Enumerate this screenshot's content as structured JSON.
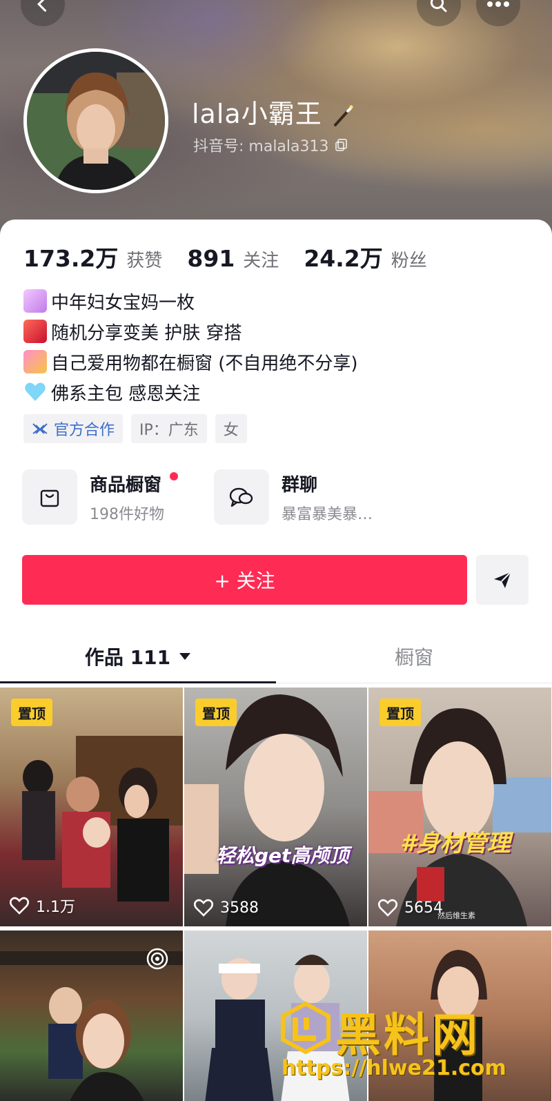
{
  "profile": {
    "name": "lala小霸王",
    "douyin_id": "抖音号: malala313"
  },
  "stats": [
    {
      "value": "173.2万",
      "label": "获赞"
    },
    {
      "value": "891",
      "label": "关注"
    },
    {
      "value": "24.2万",
      "label": "粉丝"
    }
  ],
  "bio": [
    {
      "icon": "unicorn-emoji",
      "text": "中年妇女宝妈一枚"
    },
    {
      "icon": "dancer-emoji",
      "text": "随机分享变美 护肤 穿搭"
    },
    {
      "icon": "shopping-bags-emoji",
      "text": "自己爱用物都在橱窗 (不自用绝不分享)"
    },
    {
      "icon": "blue-heart-emoji",
      "text": "佛系主包 感恩关注"
    }
  ],
  "tags": {
    "official": "官方合作",
    "ip": "IP：广东",
    "gender": "女"
  },
  "entries": {
    "shop": {
      "title": "商品橱窗",
      "subtitle": "198件好物"
    },
    "group": {
      "title": "群聊",
      "subtitle": "暴富暴美暴…"
    }
  },
  "follow_label": "+ 关注",
  "tabs": {
    "works": "作品 111",
    "showcase": "橱窗"
  },
  "videos": [
    {
      "pinned": "置顶",
      "likes": "1.1万"
    },
    {
      "pinned": "置顶",
      "likes": "3588",
      "overlay": "轻松get高颅顶"
    },
    {
      "pinned": "置顶",
      "likes": "5654",
      "overlay": "#身材管理",
      "caption": "然后维生素"
    }
  ],
  "watermark": {
    "brand": "黑料网",
    "url": "https://hlwe21.com"
  },
  "colors": {
    "accent": "#fe2c55",
    "pin": "#facd2c",
    "watermark": "#f7c31a"
  }
}
